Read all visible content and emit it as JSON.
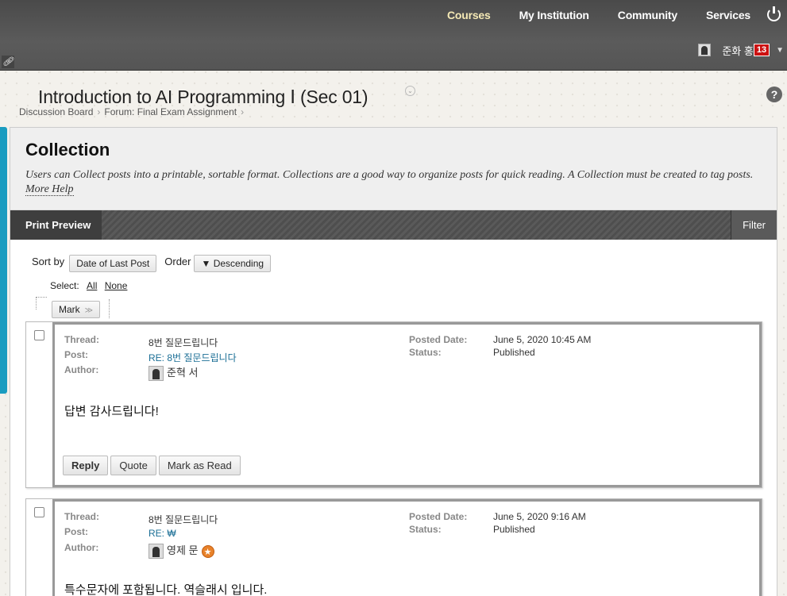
{
  "topnav": {
    "items": [
      "Courses",
      "My Institution",
      "Community",
      "Services"
    ]
  },
  "user": {
    "name": "준화 홍",
    "notifications": "13"
  },
  "course": {
    "title": "Introduction to AI Programming Ⅰ (Sec 01)"
  },
  "breadcrumb": [
    "Discussion Board",
    "Forum: Final Exam Assignment"
  ],
  "collection": {
    "heading": "Collection",
    "description": "Users can Collect posts into a printable, sortable format. Collections are a good way to organize posts for quick reading. A Collection must be created to tag posts.",
    "help_link": "More Help"
  },
  "actionbar": {
    "print_preview": "Print Preview",
    "filter": "Filter"
  },
  "sort": {
    "sort_by_label": "Sort by",
    "sort_by_value": "Date of Last Post",
    "order_label": "Order",
    "order_value": "▼ Descending"
  },
  "select": {
    "label": "Select:",
    "all": "All",
    "none": "None",
    "mark": "Mark"
  },
  "labels": {
    "thread": "Thread:",
    "post": "Post:",
    "author": "Author:",
    "posted_date": "Posted Date:",
    "status": "Status:"
  },
  "posts": [
    {
      "thread": "8번 질문드립니다",
      "post": "RE: 8번 질문드립니다",
      "author": "준혁 서",
      "posted_date": "June 5, 2020 10:45 AM",
      "status": "Published",
      "body": "답변 감사드립니다!",
      "buttons": [
        "Reply",
        "Quote",
        "Mark as Read"
      ]
    },
    {
      "thread": "8번 질문드립니다",
      "post": "RE: ₩",
      "author": "영제 문",
      "posted_date": "June 5, 2020 9:16 AM",
      "status": "Published",
      "body": "특수문자에 포함됩니다. 역슬래시 입니다."
    }
  ]
}
